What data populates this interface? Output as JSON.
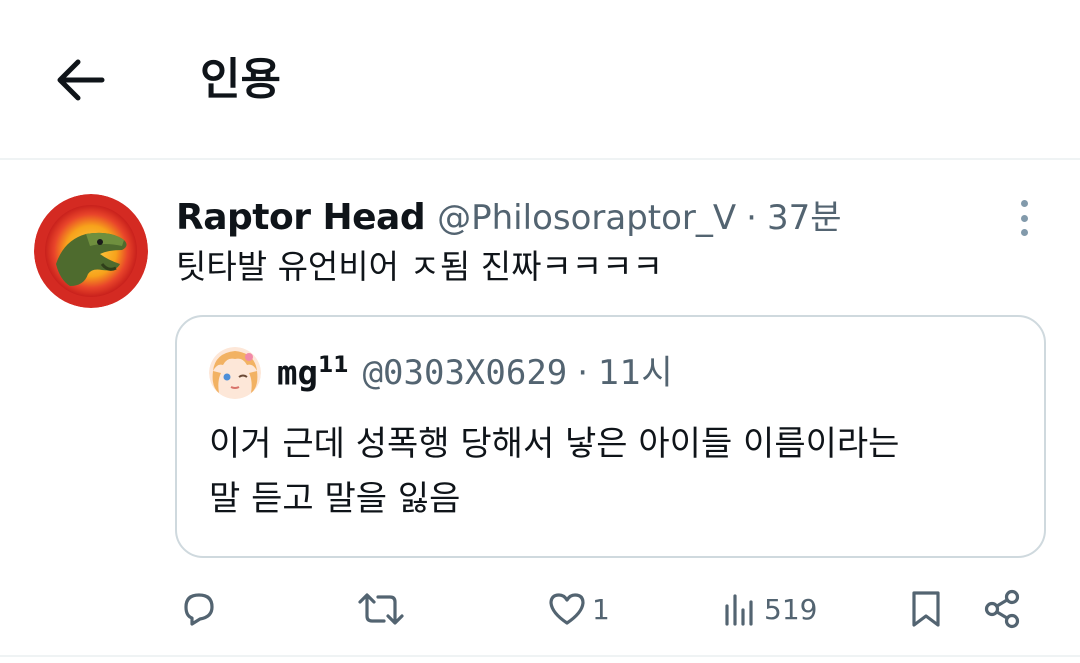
{
  "header": {
    "title": "인용"
  },
  "tweet": {
    "author_name": "Raptor Head",
    "author_handle": "@Philosoraptor_V",
    "separator": "·",
    "time": "37분",
    "text": "팃타발 유언비어 ㅈ됨 진짜ㅋㅋㅋㅋ"
  },
  "quote": {
    "author_name": "mg",
    "author_sup": "11",
    "author_handle": "@0303X0629",
    "separator": "·",
    "time": "11시",
    "text_line1": "이거 근데 성폭행 당해서 낳은 아이들 이름이라는",
    "text_line2": "말 듣고 말을 잃음"
  },
  "actions": {
    "reply_icon": "reply-icon",
    "retweet_icon": "retweet-icon",
    "like_icon": "heart-icon",
    "like_count": "1",
    "views_icon": "views-icon",
    "views_count": "519",
    "bookmark_icon": "bookmark-icon",
    "share_icon": "share-icon"
  },
  "colors": {
    "text": "#0f1419",
    "secondary": "#536471",
    "border": "#cfd9de",
    "divider": "#eff3f4"
  }
}
